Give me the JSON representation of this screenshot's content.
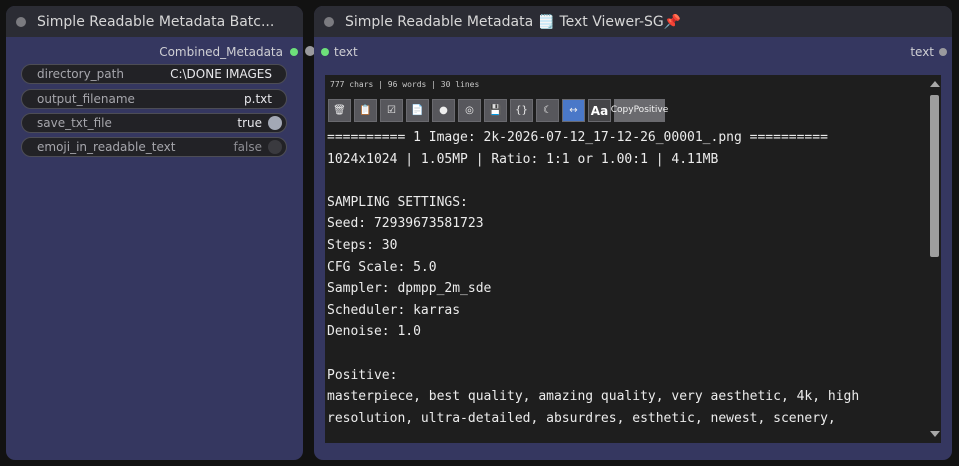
{
  "left_node": {
    "title": "Simple Readable Metadata Batc...",
    "output_label": "Combined_Metadata",
    "widgets": [
      {
        "label": "directory_path",
        "value": "C:\\DONE IMAGES"
      },
      {
        "label": "output_filename",
        "value": "p.txt"
      },
      {
        "label": "save_txt_file",
        "value": "true"
      },
      {
        "label": "emoji_in_readable_text",
        "value": "false"
      }
    ]
  },
  "right_node": {
    "title": "Simple Readable Metadata 🗒️ Text Viewer-SG📌",
    "input_label": "text",
    "output_label": "text",
    "stats": "777 chars | 96 words | 30 lines",
    "toolbar": {
      "copy_label_line1": "Copy",
      "copy_label_line2": "Positive",
      "font_button": "Aa",
      "icons": [
        "trash-icon",
        "clipboard-icon",
        "checkbox-icon",
        "document-icon",
        "circle-icon",
        "target-icon",
        "floppy-icon",
        "braces-icon",
        "moon-icon",
        "expand-icon"
      ]
    },
    "content": [
      "========== 1 Image: 2k-2026-07-12_17-12-26_00001_.png ==========",
      "1024x1024 | 1.05MP | Ratio: 1:1 or 1.00:1 | 4.11MB",
      "",
      "SAMPLING SETTINGS:",
      "Seed: 729396735817​23",
      "Steps: 30",
      "CFG Scale: 5.0",
      "Sampler: dpmpp_2m_sde",
      "Scheduler: karras",
      "Denoise: 1.0",
      "",
      "Positive:",
      "masterpiece, best quality, amazing quality, very aesthetic, 4k, high",
      "resolution, ultra-detailed, absurdres, esthetic, newest, scenery,"
    ]
  }
}
